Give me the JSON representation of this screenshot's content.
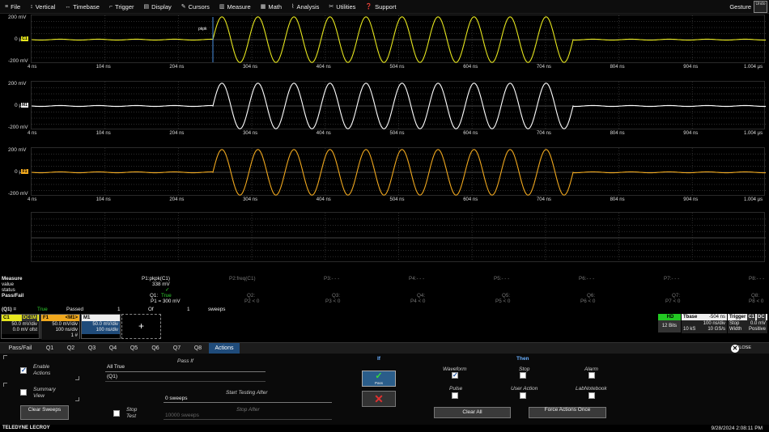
{
  "menu": [
    {
      "icon": "≡",
      "icon_name": "file-icon",
      "label": "File"
    },
    {
      "icon": "↕",
      "icon_name": "vertical-icon",
      "label": "Vertical"
    },
    {
      "icon": "↔",
      "icon_name": "timebase-icon",
      "label": "Timebase"
    },
    {
      "icon": "⌐",
      "icon_name": "trigger-icon",
      "label": "Trigger"
    },
    {
      "icon": "▤",
      "icon_name": "display-icon",
      "label": "Display"
    },
    {
      "icon": "✎",
      "icon_name": "cursors-icon",
      "label": "Cursors"
    },
    {
      "icon": "▥",
      "icon_name": "measure-icon",
      "label": "Measure"
    },
    {
      "icon": "▦",
      "icon_name": "math-icon",
      "label": "Math"
    },
    {
      "icon": "⌇",
      "icon_name": "analysis-icon",
      "label": "Analysis"
    },
    {
      "icon": "✂",
      "icon_name": "utilities-icon",
      "label": "Utilities"
    },
    {
      "icon": "❓",
      "icon_name": "support-icon",
      "label": "Support"
    }
  ],
  "gesture_label": "Gesture",
  "gesture_box": "Undo",
  "x_ticks": [
    "4 ns",
    "104 ns",
    "204 ns",
    "304 ns",
    "404 ns",
    "504 ns",
    "604 ns",
    "704 ns",
    "804 ns",
    "904 ns",
    "1.004 µs"
  ],
  "grids": [
    {
      "y_top": "200 mV",
      "y_mid": "0 µV",
      "y_bot": "-200 mV",
      "color": "#e6e61e",
      "marker_color": "#e6e61e",
      "marker": "C1",
      "cursor_label": "pkpk"
    },
    {
      "y_top": "200 mV",
      "y_mid": "0 µV",
      "y_bot": "-200 mV",
      "color": "#ffffff",
      "marker_color": "#eeeeee",
      "marker": "M1"
    },
    {
      "y_top": "200 mV",
      "y_mid": "0 µV",
      "y_bot": "-200 mV",
      "color": "#f0a81e",
      "marker_color": "#f0a81e",
      "marker": "F1"
    }
  ],
  "measure": {
    "header": "Measure",
    "value_label": "value",
    "status_label": "status",
    "passfail_label": "Pass/Fail",
    "params": [
      "P1:pkpk(C1)",
      "P2:freq(C1)",
      "P3:- - -",
      "P4:- - -",
      "P5:- - -",
      "P6:- - -",
      "P7:- - -",
      "P8:- - -"
    ],
    "p1_value": "338 mV",
    "p1_status": "✓",
    "q_labels": [
      "Q1:",
      "Q2:",
      "Q3:",
      "Q4:",
      "Q5:",
      "Q6:",
      "Q7:",
      "Q8:"
    ],
    "q1_result": "True",
    "q_conditions": [
      "P1 = 300 mV",
      "P2 < 0",
      "P3 < 0",
      "P4 < 0",
      "P5 < 0",
      "P6 < 0",
      "P7 < 0",
      "P8 < 0"
    ],
    "summary_q": "(Q1) =",
    "summary_result": "True",
    "summary_passed": "Passed",
    "summary_count1": "1",
    "summary_of": "Of",
    "summary_count2": "1",
    "summary_sweeps": "sweeps"
  },
  "descriptors": {
    "c1": {
      "name": "C1",
      "tag": "DC1M",
      "line1": "50.0 mV/div",
      "line2": "0.0 mV ofst"
    },
    "f1": {
      "name": "F1",
      "tag": "<M1>",
      "line1": "50.0 mV/div",
      "line2": "100 ns/div",
      "line3": "1 #"
    },
    "m1": {
      "name": "M1",
      "line1": "50.0 mV/div",
      "line2": "100 ns/div"
    },
    "add": "+",
    "hd": {
      "label": "HD",
      "bits": "12 Bits"
    },
    "tbase": {
      "label": "Tbase",
      "offset": "-504 ns",
      "div": "100 ns/div",
      "samples": "10 kS",
      "rate": "10 GS/s"
    },
    "trigger": {
      "label": "Trigger",
      "tags": [
        "C1",
        "DC"
      ],
      "mode": "Stop",
      "level": "0.0 mV",
      "type": "Width",
      "slope": "Positive"
    }
  },
  "tabs": [
    "Pass/Fail",
    "Q1",
    "Q2",
    "Q3",
    "Q4",
    "Q5",
    "Q6",
    "Q7",
    "Q8",
    "Actions"
  ],
  "active_tab": "Actions",
  "close_label": "CLOSE",
  "panel": {
    "enable_actions": "Enable Actions",
    "summary_view": "Summary View",
    "clear_sweeps": "Clear Sweeps",
    "stop_test": "Stop Test",
    "pass_if": "Pass If",
    "pass_if_value": "All True",
    "pass_if_expr": "(Q1)",
    "start_testing": "Start Testing After",
    "start_value": "0 sweeps",
    "stop_after": "Stop After",
    "stop_value": "10000 sweeps",
    "if_label": "If",
    "pass_btn": "Pass",
    "then_label": "Then",
    "actions": [
      {
        "label": "Waveform",
        "checked": true
      },
      {
        "label": "Stop",
        "checked": false
      },
      {
        "label": "Alarm",
        "checked": false
      },
      {
        "label": "Pulse",
        "checked": false
      },
      {
        "label": "User Action",
        "checked": false
      },
      {
        "label": "LabNotebook",
        "checked": false
      }
    ],
    "clear_all": "Clear All",
    "force_actions": "Force Actions Once"
  },
  "status": {
    "brand": "TELEDYNE LECROY",
    "datetime": "9/28/2024 2:08:11 PM"
  }
}
